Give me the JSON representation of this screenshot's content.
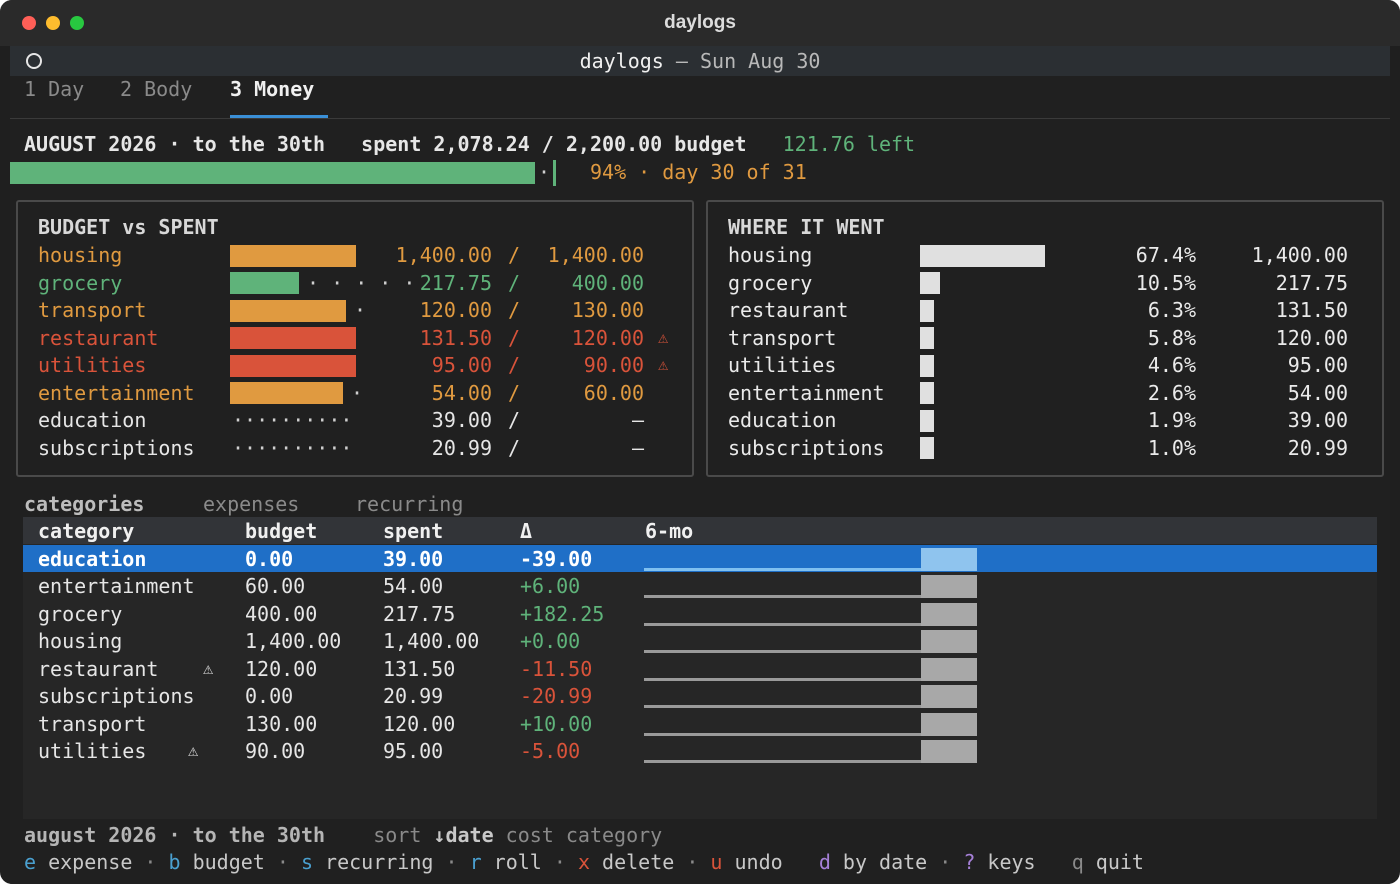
{
  "window": {
    "title": "daylogs"
  },
  "app": {
    "name": "daylogs",
    "separator": "—",
    "date": "Sun Aug 30"
  },
  "tabs": [
    {
      "num": "1",
      "label": "Day",
      "active": false
    },
    {
      "num": "2",
      "label": "Body",
      "active": false
    },
    {
      "num": "3",
      "label": "Money",
      "active": true
    }
  ],
  "summary": {
    "period": "AUGUST 2026 · to the 30th",
    "spent_label": "spent",
    "spent": "2,078.24",
    "slash": "/",
    "budget": "2,200.00",
    "budget_label": "budget",
    "left": "121.76 left",
    "percent": "94%",
    "day_text": "· day 30 of 31",
    "progress": 0.94
  },
  "budget_panel": {
    "title": "BUDGET vs SPENT",
    "rows": [
      {
        "name": "housing",
        "spent": "1,400.00",
        "budget": "1,400.00",
        "ratio": 1.0,
        "status": "orange",
        "warn": ""
      },
      {
        "name": "grocery",
        "spent": "217.75",
        "budget": "400.00",
        "ratio": 0.544,
        "status": "green",
        "warn": ""
      },
      {
        "name": "transport",
        "spent": "120.00",
        "budget": "130.00",
        "ratio": 0.923,
        "status": "orange",
        "warn": ""
      },
      {
        "name": "restaurant",
        "spent": "131.50",
        "budget": "120.00",
        "ratio": 1.0,
        "status": "red",
        "warn": "⚠"
      },
      {
        "name": "utilities",
        "spent": "95.00",
        "budget": "90.00",
        "ratio": 1.0,
        "status": "red",
        "warn": "⚠"
      },
      {
        "name": "entertainment",
        "spent": "54.00",
        "budget": "60.00",
        "ratio": 0.9,
        "status": "orange",
        "warn": ""
      },
      {
        "name": "education",
        "spent": "39.00",
        "budget": "—",
        "ratio": 0,
        "status": "none",
        "warn": ""
      },
      {
        "name": "subscriptions",
        "spent": "20.99",
        "budget": "—",
        "ratio": 0,
        "status": "none",
        "warn": ""
      }
    ]
  },
  "where_panel": {
    "title": "WHERE IT WENT",
    "rows": [
      {
        "name": "housing",
        "pct": "67.4%",
        "amount": "1,400.00",
        "share": 0.674
      },
      {
        "name": "grocery",
        "pct": "10.5%",
        "amount": "217.75",
        "share": 0.105
      },
      {
        "name": "restaurant",
        "pct": "6.3%",
        "amount": "131.50",
        "share": 0.063
      },
      {
        "name": "transport",
        "pct": "5.8%",
        "amount": "120.00",
        "share": 0.058
      },
      {
        "name": "utilities",
        "pct": "4.6%",
        "amount": "95.00",
        "share": 0.046
      },
      {
        "name": "entertainment",
        "pct": "2.6%",
        "amount": "54.00",
        "share": 0.026
      },
      {
        "name": "education",
        "pct": "1.9%",
        "amount": "39.00",
        "share": 0.019
      },
      {
        "name": "subscriptions",
        "pct": "1.0%",
        "amount": "20.99",
        "share": 0.01
      }
    ]
  },
  "subtabs": [
    {
      "label": "categories",
      "active": true
    },
    {
      "label": "expenses",
      "active": false
    },
    {
      "label": "recurring",
      "active": false
    }
  ],
  "table": {
    "columns": [
      "category",
      "budget",
      "spent",
      "Δ",
      "6-mo"
    ],
    "rows": [
      {
        "category": "education",
        "warn": "",
        "budget": "0.00",
        "spent": "39.00",
        "delta": "-39.00",
        "sign": "neg",
        "selected": true
      },
      {
        "category": "entertainment",
        "warn": "",
        "budget": "60.00",
        "spent": "54.00",
        "delta": "+6.00",
        "sign": "pos",
        "selected": false
      },
      {
        "category": "grocery",
        "warn": "",
        "budget": "400.00",
        "spent": "217.75",
        "delta": "+182.25",
        "sign": "pos",
        "selected": false
      },
      {
        "category": "housing",
        "warn": "",
        "budget": "1,400.00",
        "spent": "1,400.00",
        "delta": "+0.00",
        "sign": "pos",
        "selected": false
      },
      {
        "category": "restaurant",
        "warn": "⚠",
        "budget": "120.00",
        "spent": "131.50",
        "delta": "-11.50",
        "sign": "neg",
        "selected": false
      },
      {
        "category": "subscriptions",
        "warn": "",
        "budget": "0.00",
        "spent": "20.99",
        "delta": "-20.99",
        "sign": "neg",
        "selected": false
      },
      {
        "category": "transport",
        "warn": "",
        "budget": "130.00",
        "spent": "120.00",
        "delta": "+10.00",
        "sign": "pos",
        "selected": false
      },
      {
        "category": "utilities",
        "warn": "⚠",
        "budget": "90.00",
        "spent": "95.00",
        "delta": "-5.00",
        "sign": "neg",
        "selected": false
      }
    ]
  },
  "status": {
    "period": "august 2026 · to the 30th",
    "sort_label": "sort",
    "sort_options": [
      {
        "label": "↓date",
        "active": true
      },
      {
        "label": "cost",
        "active": false
      },
      {
        "label": "category",
        "active": false
      }
    ]
  },
  "keys": [
    {
      "key": "e",
      "label": "expense",
      "color": "#4aa0d0"
    },
    {
      "key": "b",
      "label": "budget",
      "color": "#4aa0d0"
    },
    {
      "key": "s",
      "label": "recurring",
      "color": "#4aa0d0"
    },
    {
      "key": "r",
      "label": "roll",
      "color": "#4aa0d0"
    },
    {
      "key": "x",
      "label": "delete",
      "color": "#d9533a"
    },
    {
      "key": "u",
      "label": "undo",
      "color": "#d9533a"
    },
    {
      "key": "d",
      "label": "by date",
      "color": "#a680d8"
    },
    {
      "key": "?",
      "label": "keys",
      "color": "#a680d8"
    },
    {
      "key": "q",
      "label": "quit",
      "color": "#8a8a8a"
    }
  ],
  "colors": {
    "green": "#5fb37a",
    "orange": "#e09a40",
    "red": "#d9533a",
    "selection": "#1f6fc7"
  }
}
